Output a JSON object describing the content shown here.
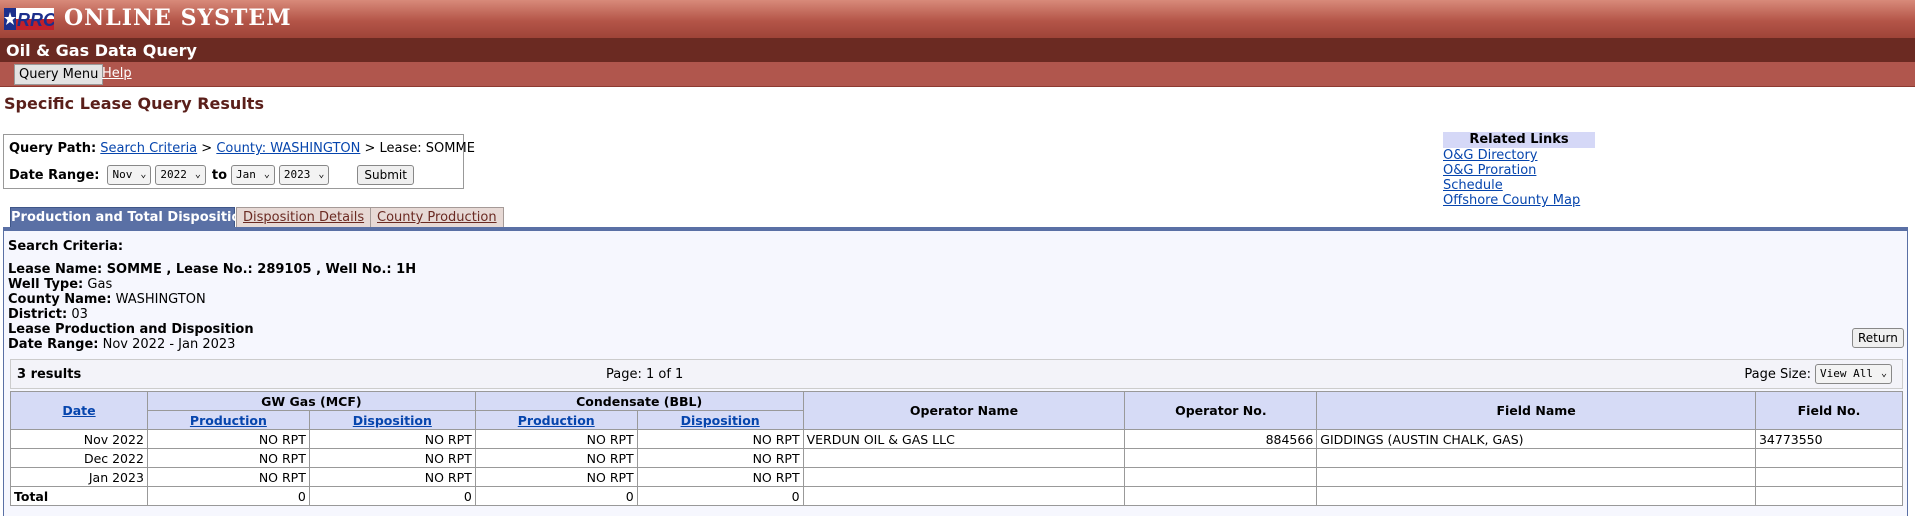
{
  "banner": {
    "logo_text": "RRC",
    "title": "ONLINE SYSTEM"
  },
  "subbar": {
    "title": "Oil & Gas Data Query"
  },
  "menu": {
    "query_menu": "Query Menu",
    "help": "Help"
  },
  "page_title": "Specific Lease Query Results",
  "query_path": {
    "label": "Query Path:",
    "crumb1": "Search Criteria",
    "sep1": ">",
    "crumb2": "County: WASHINGTON",
    "sep2": ">",
    "current": "Lease: SOMME"
  },
  "date_range": {
    "label": "Date Range:",
    "from_month": "Nov",
    "from_year": "2022",
    "to_label": "to",
    "to_month": "Jan",
    "to_year": "2023",
    "submit": "Submit"
  },
  "related": {
    "heading": "Related Links",
    "links": [
      "O&G Directory",
      "O&G Proration Schedule",
      "Offshore County Map"
    ]
  },
  "tabs": [
    "Production and Total Disposition",
    "Disposition Details",
    "County Production"
  ],
  "criteria": {
    "heading": "Search Criteria:",
    "lease_line": "Lease Name: SOMME , Lease No.: 289105 , Well No.: 1H",
    "well_type_label": "Well Type:",
    "well_type": "Gas",
    "county_label": "County Name:",
    "county": "WASHINGTON",
    "district_label": "District:",
    "district": "03",
    "lease_prod": "Lease Production and Disposition",
    "date_range_label": "Date Range:",
    "date_range": "Nov 2022 - Jan 2023"
  },
  "return_button": "Return",
  "results": {
    "count": "3 results",
    "page": "Page: 1 of 1",
    "page_size_label": "Page Size:",
    "page_size_value": "View All"
  },
  "table": {
    "col_date": "Date",
    "group_gw": "GW Gas (MCF)",
    "group_cond": "Condensate (BBL)",
    "sub_production": "Production",
    "sub_disposition": "Disposition",
    "col_operator": "Operator Name",
    "col_operator_no": "Operator No.",
    "col_field": "Field Name",
    "col_field_no": "Field No.",
    "rows": [
      [
        "Nov 2022",
        "NO RPT",
        "NO RPT",
        "NO RPT",
        "NO RPT",
        "VERDUN OIL & GAS LLC",
        "884566",
        "GIDDINGS (AUSTIN CHALK, GAS)",
        "34773550"
      ],
      [
        "Dec 2022",
        "NO RPT",
        "NO RPT",
        "NO RPT",
        "NO RPT",
        "",
        "",
        "",
        ""
      ],
      [
        "Jan 2023",
        "NO RPT",
        "NO RPT",
        "NO RPT",
        "NO RPT",
        "",
        "",
        "",
        ""
      ]
    ],
    "total": [
      "Total",
      "0",
      "0",
      "0",
      "0",
      "",
      "",
      "",
      ""
    ]
  }
}
